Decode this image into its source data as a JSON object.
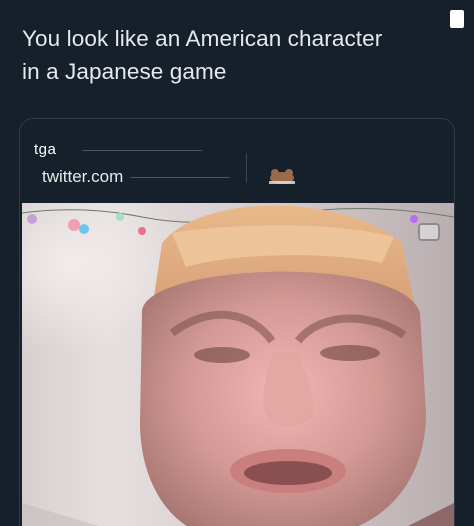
{
  "tweet": {
    "text_line1": "You look like an American character",
    "text_line2": "in a Japanese game"
  },
  "card": {
    "handle": "tga",
    "domain": "twitter.com",
    "emoji_avatar": "bear-emoji"
  },
  "media": {
    "type": "video",
    "icon": "video-camera-icon"
  },
  "colors": {
    "background": "#15202b",
    "text": "#e7e9ea",
    "border": "#2f3a45"
  }
}
